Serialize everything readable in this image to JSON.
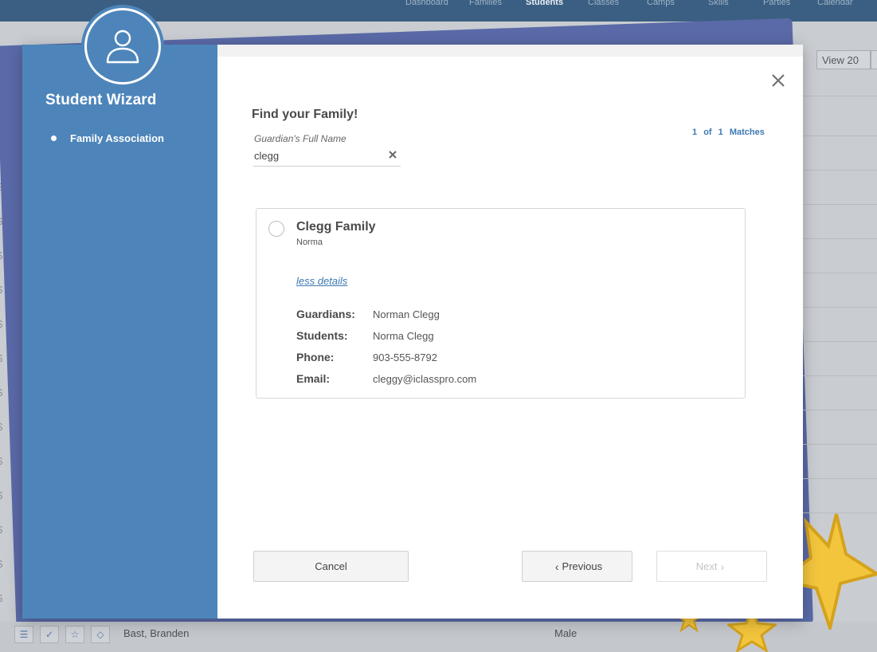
{
  "background": {
    "nav": [
      {
        "label": "Dashboard",
        "active": false
      },
      {
        "label": "Families",
        "active": false
      },
      {
        "label": "Students",
        "active": true
      },
      {
        "label": "Classes",
        "active": false
      },
      {
        "label": "Camps",
        "active": false
      },
      {
        "label": "Skills",
        "active": false
      },
      {
        "label": "Parties",
        "active": false
      },
      {
        "label": "Calendar",
        "active": false
      }
    ],
    "page_title_fragment": "S",
    "view_select": "View 20",
    "row_icon": "$",
    "bottom_row": {
      "name": "Bast, Branden",
      "gender": "Male"
    }
  },
  "wizard": {
    "title": "Student Wizard",
    "steps": [
      {
        "label": "Family Association",
        "active": true
      }
    ],
    "find_title": "Find your Family!",
    "search": {
      "label": "Guardian's Full Name",
      "value": "clegg"
    },
    "matches": {
      "current": "1",
      "of": "of",
      "total": "1",
      "label": "Matches"
    },
    "result": {
      "family_name": "Clegg Family",
      "subtitle": "Norma",
      "details_link": "less details",
      "details": [
        {
          "key": "Guardians:",
          "value": "Norman Clegg"
        },
        {
          "key": "Students:",
          "value": "Norma Clegg"
        },
        {
          "key": "Phone:",
          "value": "903-555-8792"
        },
        {
          "key": "Email:",
          "value": "cleggy@iclasspro.com"
        }
      ]
    },
    "buttons": {
      "cancel": "Cancel",
      "previous": "Previous",
      "next": "Next"
    }
  },
  "colors": {
    "sidebar": "#4d85ba",
    "accent_link": "#3d78b3",
    "star": "#f2c53d"
  }
}
